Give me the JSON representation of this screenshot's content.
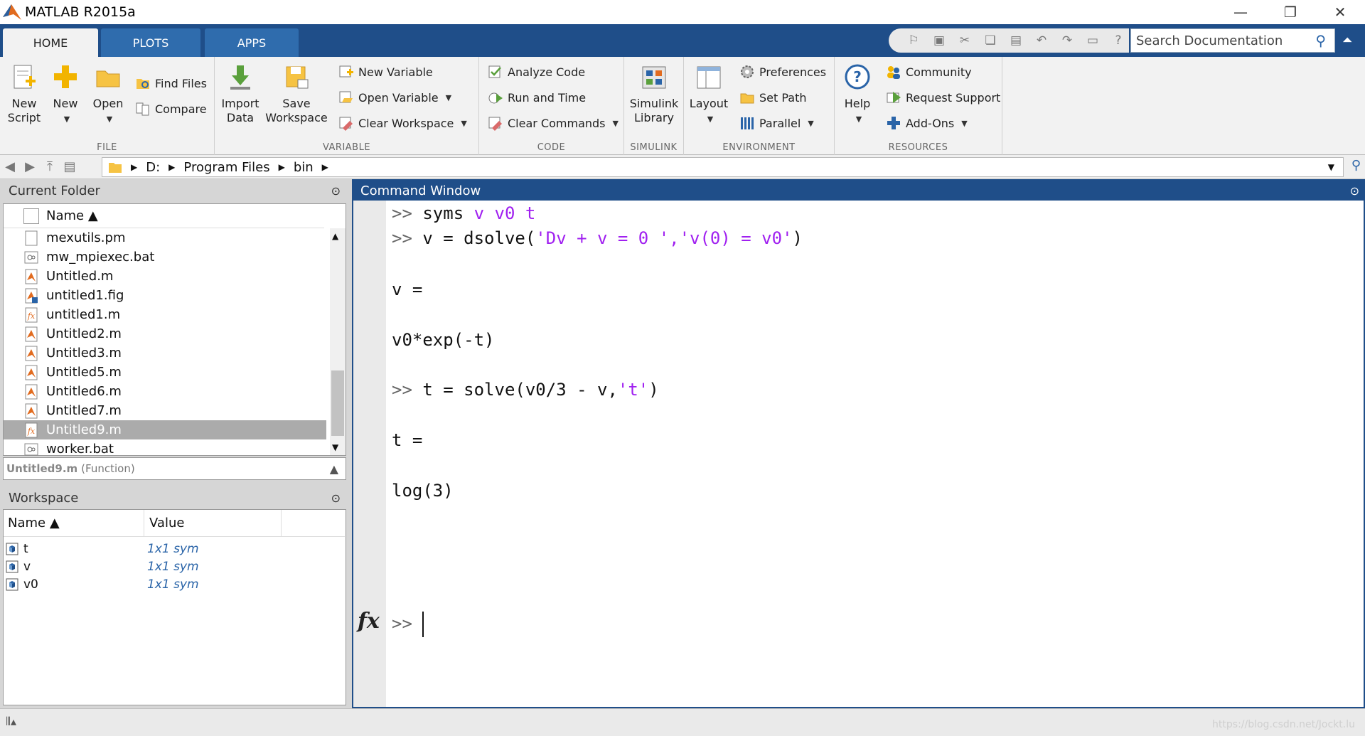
{
  "window": {
    "title": "MATLAB R2015a",
    "minimize": "—",
    "restore": "❐",
    "close": "✕"
  },
  "tabs": [
    "HOME",
    "PLOTS",
    "APPS"
  ],
  "search": {
    "placeholder": "Search Documentation"
  },
  "ribbon": {
    "file": {
      "section": "FILE",
      "new_script": [
        "New",
        "Script"
      ],
      "new": "New",
      "open": "Open",
      "find_files": "Find Files",
      "compare": "Compare"
    },
    "variable": {
      "section": "VARIABLE",
      "import": [
        "Import",
        "Data"
      ],
      "save": [
        "Save",
        "Workspace"
      ],
      "new_variable": "New Variable",
      "open_variable": "Open Variable",
      "clear_workspace": "Clear Workspace"
    },
    "code": {
      "section": "CODE",
      "analyze": "Analyze Code",
      "run_time": "Run and Time",
      "clear_commands": "Clear Commands"
    },
    "simulink": {
      "section": "SIMULINK",
      "library": [
        "Simulink",
        "Library"
      ]
    },
    "environment": {
      "section": "ENVIRONMENT",
      "layout": "Layout",
      "preferences": "Preferences",
      "set_path": "Set Path",
      "parallel": "Parallel"
    },
    "resources": {
      "section": "RESOURCES",
      "help": "Help",
      "community": "Community",
      "request_support": "Request Support",
      "add_ons": "Add-Ons"
    }
  },
  "path": {
    "segments": [
      "D:",
      "Program Files",
      "bin"
    ]
  },
  "current_folder": {
    "title": "Current Folder",
    "column": "Name ▲",
    "files": [
      {
        "name": "mexutils.pm",
        "type": "blank"
      },
      {
        "name": "mw_mpiexec.bat",
        "type": "bat"
      },
      {
        "name": "Untitled.m",
        "type": "m"
      },
      {
        "name": "untitled1.fig",
        "type": "fig"
      },
      {
        "name": "untitled1.m",
        "type": "fx"
      },
      {
        "name": "Untitled2.m",
        "type": "m"
      },
      {
        "name": "Untitled3.m",
        "type": "m"
      },
      {
        "name": "Untitled5.m",
        "type": "m"
      },
      {
        "name": "Untitled6.m",
        "type": "m"
      },
      {
        "name": "Untitled7.m",
        "type": "m"
      },
      {
        "name": "Untitled9.m",
        "type": "fx",
        "selected": true
      },
      {
        "name": "worker.bat",
        "type": "bat"
      }
    ],
    "details": {
      "name": "Untitled9.m",
      "kind": "(Function)"
    }
  },
  "workspace": {
    "title": "Workspace",
    "columns": [
      "Name ▲",
      "Value"
    ],
    "vars": [
      {
        "name": "t",
        "value": "1x1 sym"
      },
      {
        "name": "v",
        "value": "1x1 sym"
      },
      {
        "name": "v0",
        "value": "1x1 sym"
      }
    ]
  },
  "command_window": {
    "title": "Command Window",
    "prompt": ">>",
    "fx": "fx",
    "lines": [
      {
        "prompt": ">>",
        "pre": " syms ",
        "str": "v v0 t",
        "post": ""
      },
      {
        "prompt": ">>",
        "pre": " v = dsolve(",
        "str": "'Dv + v = 0 ','v(0) = v0'",
        "post": ")"
      },
      {
        "pre": "v ="
      },
      {
        "pre": "v0*exp(-t)"
      },
      {
        "prompt": ">>",
        "pre": " t = solve(v0/3 - v,",
        "str": "'t'",
        "post": ")"
      },
      {
        "pre": "t ="
      },
      {
        "pre": "log(3)"
      }
    ]
  },
  "watermark": "https://blog.csdn.net/Jockt.lu"
}
